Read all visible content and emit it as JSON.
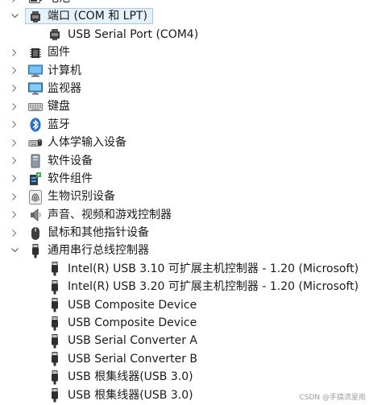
{
  "tree": {
    "rows": [
      {
        "label": "电池",
        "expanded": false,
        "level": 0,
        "icon": "battery-icon"
      },
      {
        "label": "端口 (COM 和 LPT)",
        "expanded": true,
        "level": 0,
        "icon": "port-icon",
        "selected": true
      },
      {
        "label": "USB Serial Port (COM4)",
        "level": 1,
        "icon": "port-icon"
      },
      {
        "label": "固件",
        "expanded": false,
        "level": 0,
        "icon": "firmware-chip-icon"
      },
      {
        "label": "计算机",
        "expanded": false,
        "level": 0,
        "icon": "computer-icon"
      },
      {
        "label": "监视器",
        "expanded": false,
        "level": 0,
        "icon": "monitor-icon"
      },
      {
        "label": "键盘",
        "expanded": false,
        "level": 0,
        "icon": "keyboard-icon"
      },
      {
        "label": "蓝牙",
        "expanded": false,
        "level": 0,
        "icon": "bluetooth-icon"
      },
      {
        "label": "人体学输入设备",
        "expanded": false,
        "level": 0,
        "icon": "hid-icon"
      },
      {
        "label": "软件设备",
        "expanded": false,
        "level": 0,
        "icon": "software-device-icon"
      },
      {
        "label": "软件组件",
        "expanded": false,
        "level": 0,
        "icon": "software-component-icon"
      },
      {
        "label": "生物识别设备",
        "expanded": false,
        "level": 0,
        "icon": "fingerprint-icon"
      },
      {
        "label": "声音、视频和游戏控制器",
        "expanded": false,
        "level": 0,
        "icon": "speaker-icon"
      },
      {
        "label": "鼠标和其他指针设备",
        "expanded": false,
        "level": 0,
        "icon": "mouse-icon"
      },
      {
        "label": "通用串行总线控制器",
        "expanded": true,
        "level": 0,
        "icon": "usb-plug-icon"
      },
      {
        "label": "Intel(R) USB 3.10 可扩展主机控制器 - 1.20 (Microsoft)",
        "level": 1,
        "icon": "usb-plug-icon"
      },
      {
        "label": "Intel(R) USB 3.20 可扩展主机控制器 - 1.20 (Microsoft)",
        "level": 1,
        "icon": "usb-plug-icon"
      },
      {
        "label": "USB Composite Device",
        "level": 1,
        "icon": "usb-plug-icon"
      },
      {
        "label": "USB Composite Device",
        "level": 1,
        "icon": "usb-plug-icon"
      },
      {
        "label": "USB Serial Converter A",
        "level": 1,
        "icon": "usb-plug-icon"
      },
      {
        "label": "USB Serial Converter B",
        "level": 1,
        "icon": "usb-plug-icon"
      },
      {
        "label": "USB 根集线器(USB 3.0)",
        "level": 1,
        "icon": "usb-plug-icon"
      },
      {
        "label": "USB 根集线器(USB 3.0)",
        "level": 1,
        "icon": "usb-plug-icon"
      }
    ]
  },
  "watermark": "CSDN @手搞流星雨"
}
